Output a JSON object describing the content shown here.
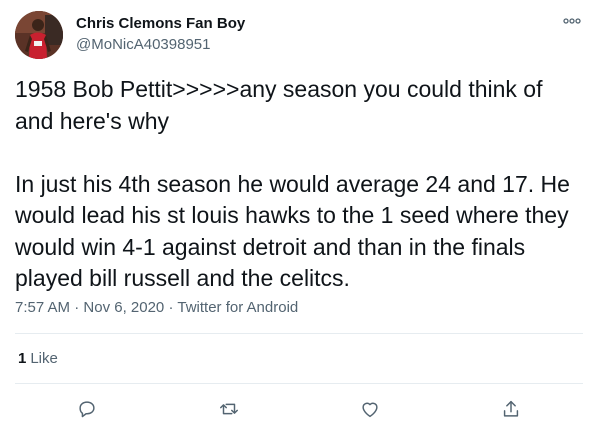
{
  "user": {
    "display_name": "Chris Clemons Fan Boy",
    "handle": "@MoNicA40398951"
  },
  "tweet": {
    "paragraphs": [
      "1958 Bob Pettit>>>>>any season you could think of and here's why",
      "In just his 4th season he would average 24 and 17. He would lead his st louis hawks to the 1 seed where they would win 4-1 against detroit and than in the finals played bill russell and the celitcs."
    ],
    "time": "7:57 AM",
    "separator_1": "·",
    "date": "Nov 6, 2020",
    "separator_2": "·",
    "source": "Twitter for Android"
  },
  "stats": {
    "likes_count": "1",
    "likes_label": "Like"
  },
  "icons": {
    "more": "more-horizontal-icon",
    "reply": "reply-icon",
    "retweet": "retweet-icon",
    "like": "heart-icon",
    "share": "share-icon"
  },
  "colors": {
    "text": "#0f1419",
    "secondary": "#536471",
    "icon": "#536471",
    "divider": "#e6ecf0"
  }
}
